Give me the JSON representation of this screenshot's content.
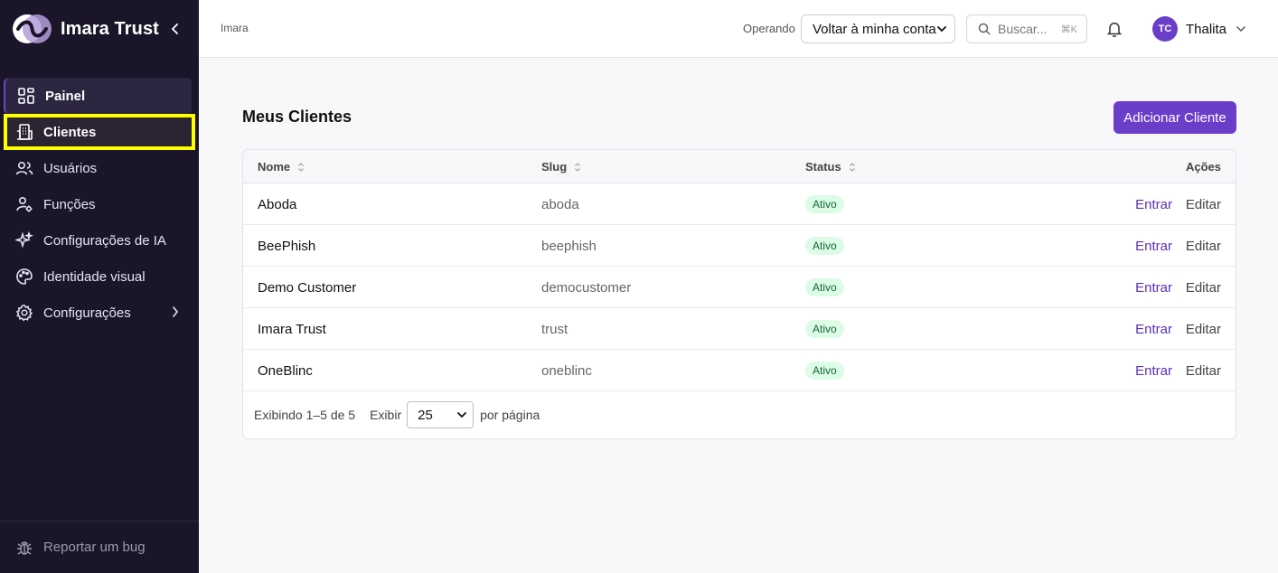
{
  "brand": {
    "name": "Imara Trust"
  },
  "sidebar": {
    "items": [
      {
        "label": "Painel",
        "icon": "dashboard-icon"
      },
      {
        "label": "Clientes",
        "icon": "building-icon"
      },
      {
        "label": "Usuários",
        "icon": "users-icon"
      },
      {
        "label": "Funções",
        "icon": "user-role-icon"
      },
      {
        "label": "Configurações de IA",
        "icon": "sparkles-icon"
      },
      {
        "label": "Identidade visual",
        "icon": "palette-icon"
      },
      {
        "label": "Configurações",
        "icon": "gear-icon"
      }
    ],
    "footer": {
      "label": "Reportar um bug",
      "icon": "bug-icon"
    }
  },
  "header": {
    "breadcrumb": "Imara",
    "operating_label": "Operando",
    "operating_value": "Voltar à minha conta",
    "search_placeholder": "Buscar...",
    "search_shortcut": "⌘K",
    "user_initials": "TC",
    "user_name": "Thalita"
  },
  "main": {
    "title": "Meus Clientes",
    "add_button": "Adicionar Cliente",
    "columns": {
      "name": "Nome",
      "slug": "Slug",
      "status": "Status",
      "actions": "Ações"
    },
    "rows": [
      {
        "name": "Aboda",
        "slug": "aboda",
        "status": "Ativo",
        "enter": "Entrar",
        "edit": "Editar"
      },
      {
        "name": "BeePhish",
        "slug": "beephish",
        "status": "Ativo",
        "enter": "Entrar",
        "edit": "Editar"
      },
      {
        "name": "Demo Customer",
        "slug": "democustomer",
        "status": "Ativo",
        "enter": "Entrar",
        "edit": "Editar"
      },
      {
        "name": "Imara Trust",
        "slug": "trust",
        "status": "Ativo",
        "enter": "Entrar",
        "edit": "Editar"
      },
      {
        "name": "OneBlinc",
        "slug": "oneblinc",
        "status": "Ativo",
        "enter": "Entrar",
        "edit": "Editar"
      }
    ],
    "pagination": {
      "showing": "Exibindo 1–5 de 5",
      "show_label": "Exibir",
      "per_page_value": "25",
      "per_page_suffix": "por página"
    }
  },
  "colors": {
    "sidebar_bg": "#1b1529",
    "accent": "#6b3ec9",
    "highlight": "#ffff00",
    "badge_bg": "#dcfce7",
    "badge_text": "#166534"
  }
}
